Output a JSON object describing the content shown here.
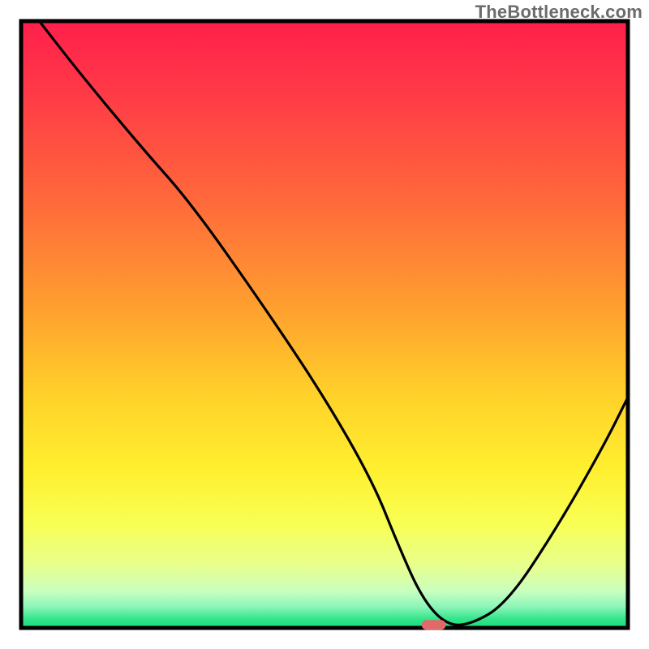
{
  "watermark": "TheBottleneck.com",
  "chart_data": {
    "type": "line",
    "title": "",
    "xlabel": "",
    "ylabel": "",
    "xlim": [
      0,
      100
    ],
    "ylim": [
      0,
      100
    ],
    "series": [
      {
        "name": "curve",
        "x": [
          3,
          10,
          20,
          28,
          40,
          50,
          58,
          62,
          66,
          70,
          74,
          80,
          88,
          96,
          100
        ],
        "y": [
          100,
          91,
          79,
          70,
          53,
          38,
          24,
          14,
          5,
          0.5,
          0.5,
          4,
          16,
          30,
          38
        ]
      }
    ],
    "marker": {
      "x": 68,
      "y": 0.5,
      "w": 4,
      "h": 1.6
    },
    "gradient_stops": [
      {
        "offset": 0,
        "color": "#ff1f4b"
      },
      {
        "offset": 0.12,
        "color": "#ff3a47"
      },
      {
        "offset": 0.3,
        "color": "#ff6a3a"
      },
      {
        "offset": 0.48,
        "color": "#ffa22f"
      },
      {
        "offset": 0.62,
        "color": "#ffd22a"
      },
      {
        "offset": 0.74,
        "color": "#fff02f"
      },
      {
        "offset": 0.83,
        "color": "#f8ff55"
      },
      {
        "offset": 0.9,
        "color": "#e6ff90"
      },
      {
        "offset": 0.94,
        "color": "#c8ffc0"
      },
      {
        "offset": 0.965,
        "color": "#8cf5b8"
      },
      {
        "offset": 0.985,
        "color": "#34e58c"
      },
      {
        "offset": 1.0,
        "color": "#18dd78"
      }
    ],
    "frame_stroke": "#000000",
    "curve_stroke": "#000000",
    "marker_color": "#e06a6a"
  }
}
